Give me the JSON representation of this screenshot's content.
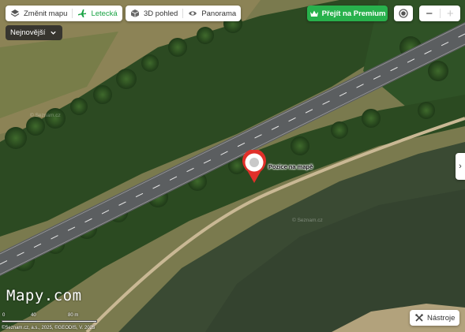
{
  "toolbar": {
    "layers": {
      "change_map_label": "Změnit mapu",
      "aerial_label": "Letecká"
    },
    "views": {
      "view3d_label": "3D pohled",
      "panorama_label": "Panorama"
    },
    "premium_label": "Přejít na Premium",
    "zoom": {
      "minus": "−",
      "plus": "+"
    }
  },
  "sort": {
    "label": "Nejnovější"
  },
  "side_tab": {
    "glyph": "›"
  },
  "marker": {
    "label": "Pozice na mapě"
  },
  "tools": {
    "label": "Nástroje"
  },
  "branding": {
    "logo": "Mapy.com"
  },
  "scale": {
    "ticks": [
      "0",
      "40",
      "80 m"
    ]
  },
  "copyright": "©Seznam.cz, a.s., 2025, ©GEODIS, V. 2025",
  "watermarks": [
    "© Seznam.cz",
    "© Seznam.cz"
  ],
  "colors": {
    "premium": "#28b14c",
    "aerial_accent": "#1aa344",
    "marker": "#e0302a"
  },
  "icons": {
    "layers": "layers-icon",
    "aerial": "airplane-icon",
    "view3d": "cube-icon",
    "panorama": "eye-icon",
    "premium": "crown-icon",
    "locate": "locate-icon",
    "tools": "tools-icon",
    "sort": "chevron-down-icon"
  }
}
